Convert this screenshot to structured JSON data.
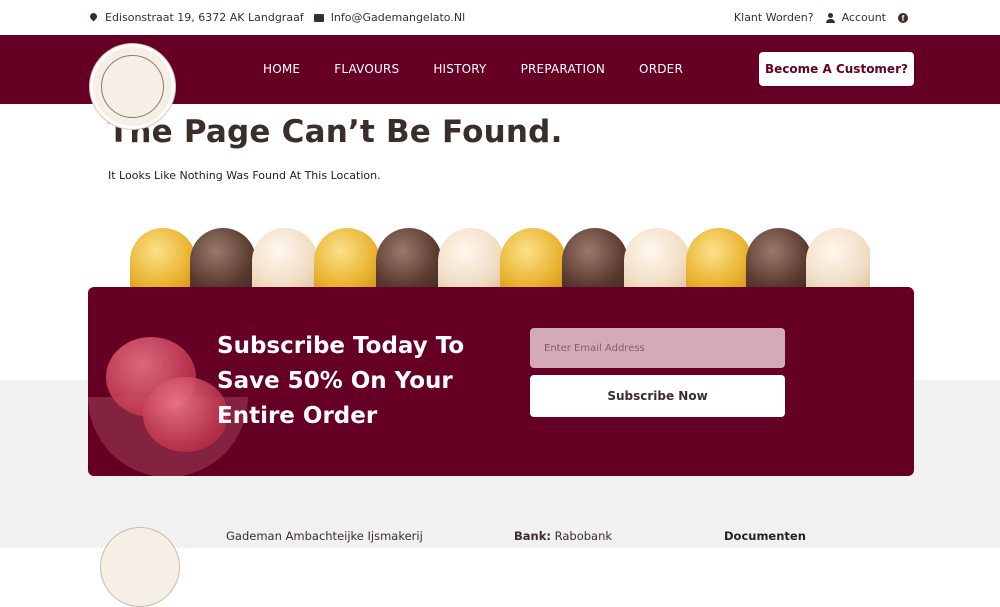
{
  "topbar": {
    "address": "Edisonstraat 19, 6372 AK Landgraaf",
    "email": "Info@Gademangelato.Nl",
    "become_client": "Klant Worden?",
    "account": "Account"
  },
  "nav": {
    "items": [
      "HOME",
      "FLAVOURS",
      "HISTORY",
      "PREPARATION",
      "ORDER"
    ],
    "cta": "Become A Customer?"
  },
  "main": {
    "title": "The Page Can’t Be Found.",
    "description": "It Looks Like Nothing Was Found At This Location."
  },
  "subscribe": {
    "title": "Subscribe Today To Save 50% On Your Entire Order",
    "email_placeholder": "Enter Email Address",
    "button": "Subscribe Now"
  },
  "footer": {
    "company": "Gademan Ambachteijke Ijsmakerij",
    "bank_label": "Bank:",
    "bank_value": "Rabobank",
    "documents": "Documenten"
  },
  "colors": {
    "brand": "#650024",
    "grey_band": "#f2f1f1"
  }
}
